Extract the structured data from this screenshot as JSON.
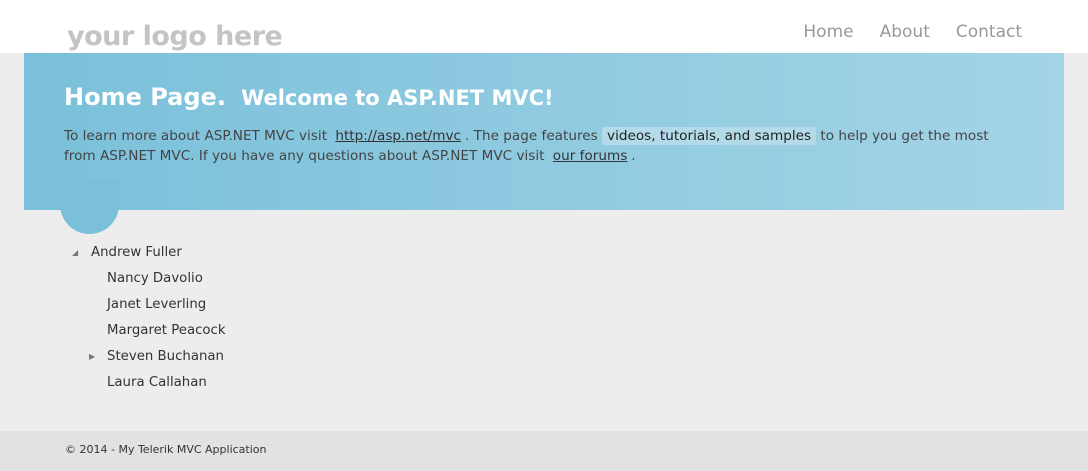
{
  "header": {
    "logo_text": "your logo here",
    "nav": [
      {
        "label": "Home"
      },
      {
        "label": "About"
      },
      {
        "label": "Contact"
      }
    ]
  },
  "featured": {
    "title_bold": "Home Page.",
    "title_rest": "Welcome to ASP.NET MVC!",
    "text_1": "To learn more about ASP.NET MVC visit",
    "link_1": "http://asp.net/mvc",
    "text_2": ". The page features",
    "highlight": "videos, tutorials, and samples",
    "text_3": "to help you get the most from ASP.NET MVC. If you have any questions about ASP.NET MVC visit",
    "link_2": "our forums",
    "text_4": "."
  },
  "tree": {
    "root": {
      "label": "Andrew Fuller",
      "expanded": true,
      "toggle_icon": "collapse-triangle-icon"
    },
    "children": [
      {
        "label": "Nancy Davolio"
      },
      {
        "label": "Janet Leverling"
      },
      {
        "label": "Margaret Peacock"
      },
      {
        "label": "Steven Buchanan",
        "expanded": false,
        "toggle_icon": "expand-triangle-icon"
      },
      {
        "label": "Laura Callahan"
      }
    ]
  },
  "footer": {
    "copyright": "© 2014 - My Telerik MVC Application"
  },
  "colors": {
    "featured_bg_start": "#7ac0da",
    "featured_bg_end": "#a4d4e6",
    "body_bg": "#ededed",
    "footer_bg": "#e2e2e2",
    "logo": "#c4c4c4",
    "nav": "#999999"
  }
}
